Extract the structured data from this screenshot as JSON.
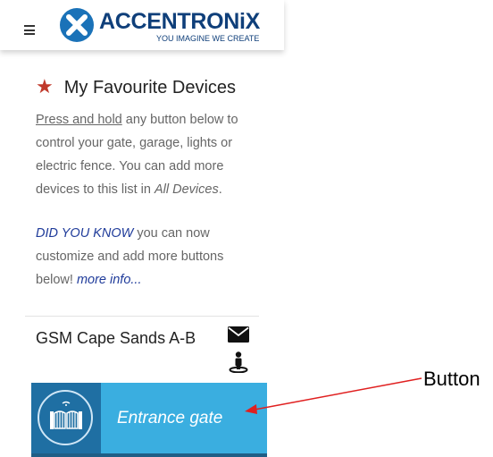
{
  "header": {
    "logo_text": "ACCENTRONiX",
    "tagline": "YOU IMAGINE WE CREATE",
    "menu_icon": "hamburger-icon",
    "brand_color": "#0f3f7a"
  },
  "favourites": {
    "title": "My Favourite Devices",
    "star_icon": "star-icon",
    "star_color": "#c0392b",
    "intro_emph": "Press and hold",
    "intro_text": " any button below to control your gate, garage, lights or electric fence. You can add more devices to this list in ",
    "intro_link": "All Devices",
    "intro_end": ".",
    "dyk_label": "DID YOU KNOW",
    "dyk_text": " you can now customize and add more buttons below! ",
    "more_info": "more info..."
  },
  "group": {
    "name": "GSM Cape Sands A-B",
    "icons": [
      "envelope-icon",
      "person-location-icon"
    ]
  },
  "device": {
    "label": "Entrance gate",
    "icon": "gate-icon",
    "button_color": "#3aaee0",
    "icon_block_color": "#1f6fa3"
  },
  "annotation": {
    "text": "Button",
    "arrow_color": "#e02020"
  }
}
